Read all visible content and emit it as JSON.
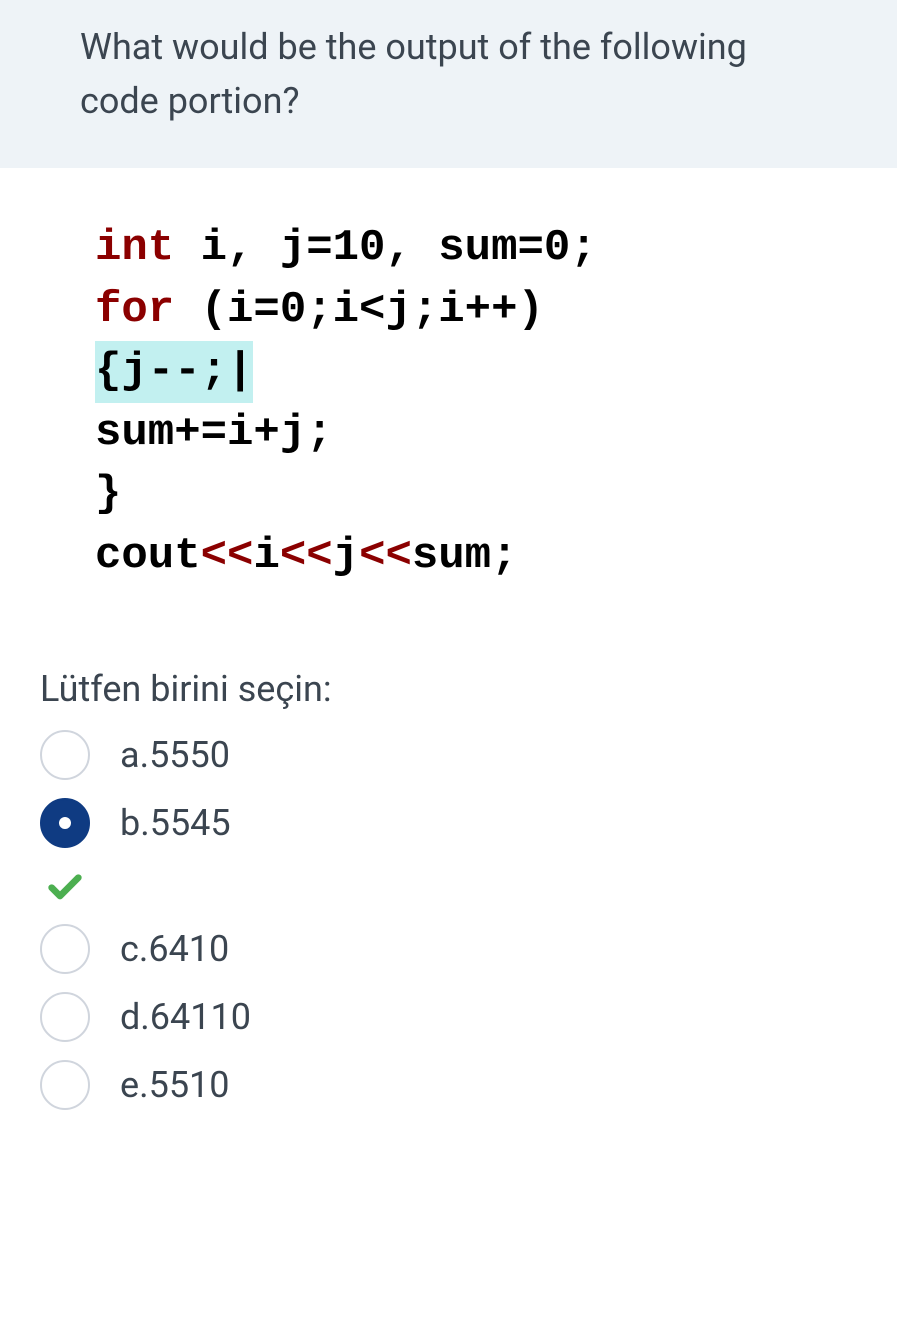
{
  "question": "What would be the output of the following code portion?",
  "code": {
    "line1_kw": "int",
    "line1_rest": " i, j=10, sum=0;",
    "line2_kw": "for",
    "line2_rest": " (i=0;i<j;i++)",
    "line3": "{j--;|",
    "line4": "sum+=i+j;",
    "line5": "}",
    "line6_pre": "cout",
    "line6_op1": "<<",
    "line6_v1": "i",
    "line6_op2": "<<",
    "line6_v2": "j",
    "line6_op3": "<<",
    "line6_v3": "sum;"
  },
  "prompt": "Lütfen birini seçin:",
  "options": {
    "a": "a.5550",
    "b": "b.5545",
    "c": "c.6410",
    "d": "d.64110",
    "e": "e.5510"
  },
  "selected": "b",
  "correct": "b"
}
